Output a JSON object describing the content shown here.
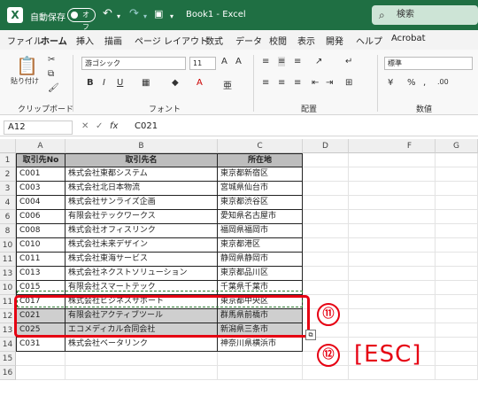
{
  "titlebar": {
    "autosave_label": "自動保存",
    "toggle_state": "オフ",
    "doc_title": "Book1  -  Excel",
    "search_placeholder": "検索",
    "logo": "X"
  },
  "tabs": [
    "ファイル",
    "ホーム",
    "挿入",
    "描画",
    "ページ レイアウト",
    "数式",
    "データ",
    "校閲",
    "表示",
    "開発",
    "ヘルプ",
    "Acrobat"
  ],
  "ribbon": {
    "paste_label": "貼り付け",
    "clipboard_group": "クリップボード",
    "font_name": "游ゴシック",
    "font_size": "11",
    "font_group": "フォント",
    "align_group": "配置",
    "number_format": "標準",
    "number_group": "数値"
  },
  "formula_bar": {
    "name_box": "A12",
    "fx": "fx",
    "value": "C021"
  },
  "columns": [
    "A",
    "B",
    "C",
    "D",
    "F",
    "G"
  ],
  "rows": [
    {
      "n": "1",
      "a": "取引先No",
      "b": "取引先名",
      "c": "所在地"
    },
    {
      "n": "2",
      "a": "C001",
      "b": "株式会社東都システム",
      "c": "東京都新宿区"
    },
    {
      "n": "3",
      "a": "C003",
      "b": "株式会社北日本物流",
      "c": "宮城県仙台市"
    },
    {
      "n": "4",
      "a": "C004",
      "b": "株式会社サンライズ企画",
      "c": "東京都渋谷区"
    },
    {
      "n": "6",
      "a": "C006",
      "b": "有限会社テックワークス",
      "c": "愛知県名古屋市"
    },
    {
      "n": "8",
      "a": "C008",
      "b": "株式会社オフィスリンク",
      "c": "福岡県福岡市"
    },
    {
      "n": "10",
      "a": "C010",
      "b": "株式会社未来デザイン",
      "c": "東京都港区"
    },
    {
      "n": "11",
      "a": "C011",
      "b": "株式会社東海サービス",
      "c": "静岡県静岡市"
    },
    {
      "n": "13",
      "a": "C013",
      "b": "株式会社ネクストソリューション",
      "c": "東京都品川区"
    },
    {
      "n": "10",
      "a": "C015",
      "b": "有限会社スマートテック",
      "c": "千葉県千葉市"
    },
    {
      "n": "11",
      "a": "C017",
      "b": "株式会社ビジネスサポート",
      "c": "東京都中央区"
    },
    {
      "n": "12",
      "a": "C021",
      "b": "有限会社アクティブツール",
      "c": "群馬県前橋市"
    },
    {
      "n": "13",
      "a": "C025",
      "b": "エコメディカル合同会社",
      "c": "新潟県三条市"
    },
    {
      "n": "14",
      "a": "C031",
      "b": "株式会社ベータリンク",
      "c": "神奈川県横浜市"
    },
    {
      "n": "15",
      "a": "",
      "b": "",
      "c": ""
    },
    {
      "n": "16",
      "a": "",
      "b": "",
      "c": ""
    }
  ],
  "annotations": {
    "step11": "⑪",
    "step12": "⑫",
    "esc_text": "[ESC]"
  }
}
